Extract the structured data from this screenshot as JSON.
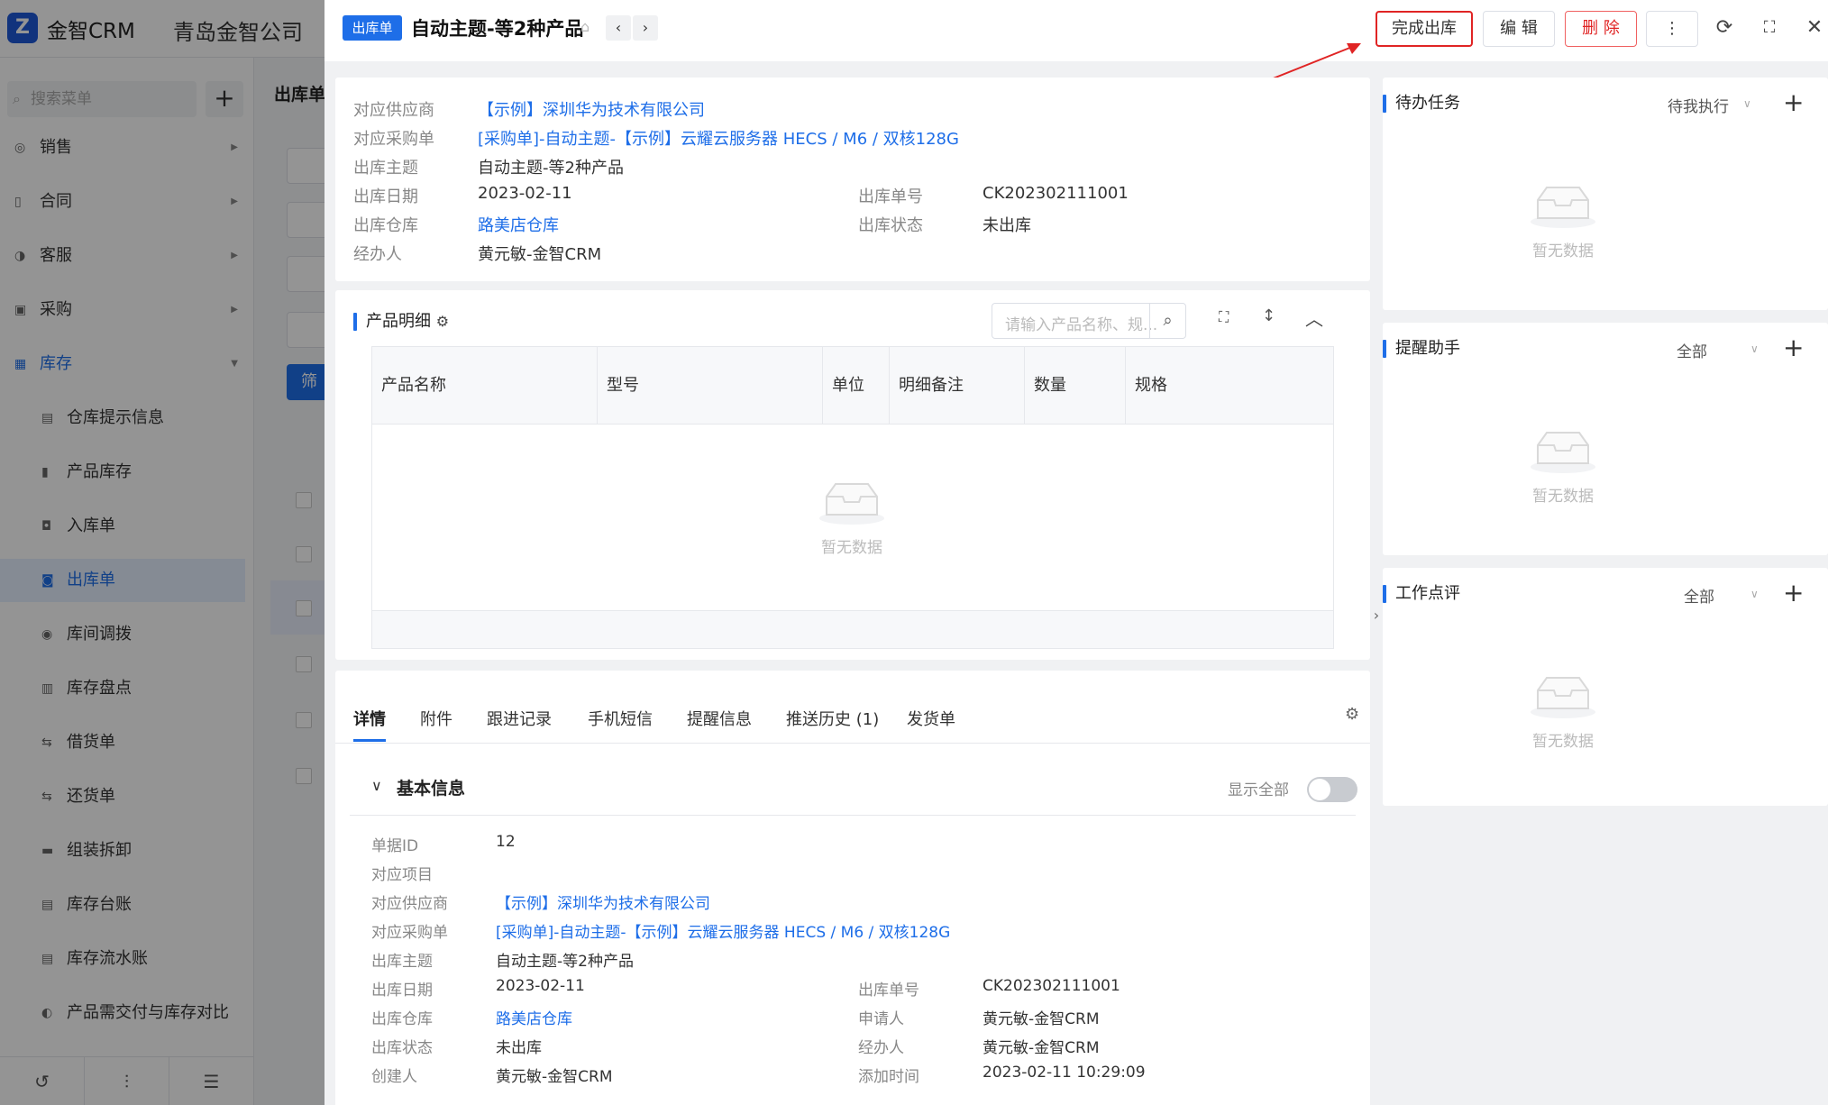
{
  "app": {
    "brand": "金智CRM",
    "company": "青岛金智公司"
  },
  "sidebar": {
    "search_placeholder": "搜索菜单",
    "menu": [
      {
        "label": "销售"
      },
      {
        "label": "合同"
      },
      {
        "label": "客服"
      },
      {
        "label": "采购"
      },
      {
        "label": "库存"
      }
    ],
    "sub_menu": [
      {
        "label": "仓库提示信息"
      },
      {
        "label": "产品库存"
      },
      {
        "label": "入库单"
      },
      {
        "label": "出库单"
      },
      {
        "label": "库间调拨"
      },
      {
        "label": "库存盘点"
      },
      {
        "label": "借货单"
      },
      {
        "label": "还货单"
      },
      {
        "label": "组装拆卸"
      },
      {
        "label": "库存台账"
      },
      {
        "label": "库存流水账"
      },
      {
        "label": "产品需交付与库存对比"
      }
    ]
  },
  "list": {
    "title": "出库单",
    "filter_label": "筛"
  },
  "drawer": {
    "tag": "出库单",
    "title": "自动主题-等2种产品",
    "buttons": {
      "complete": "完成出库",
      "edit": "编 辑",
      "delete": "删 除"
    },
    "summary": {
      "supplier_label": "对应供应商",
      "supplier_value": "【示例】深圳华为技术有限公司",
      "purchase_label": "对应采购单",
      "purchase_value": "[采购单]-自动主题-【示例】云耀云服务器 HECS / M6 / 双核128G",
      "subject_label": "出库主题",
      "subject_value": "自动主题-等2种产品",
      "date_label": "出库日期",
      "date_value": "2023-02-11",
      "number_label": "出库单号",
      "number_value": "CK202302111001",
      "warehouse_label": "出库仓库",
      "warehouse_value": "路美店仓库",
      "status_label": "出库状态",
      "status_value": "未出库",
      "handler_label": "经办人",
      "handler_value": "黄元敏-金智CRM"
    },
    "products": {
      "title": "产品明细",
      "search_placeholder": "请输入产品名称、规...",
      "columns": [
        "产品名称",
        "型号",
        "单位",
        "明细备注",
        "数量",
        "规格"
      ],
      "empty": "暂无数据"
    },
    "tabs": [
      "详情",
      "附件",
      "跟进记录",
      "手机短信",
      "提醒信息",
      "推送历史 (1)",
      "发货单"
    ],
    "basic": {
      "title": "基本信息",
      "show_all": "显示全部",
      "id_label": "单据ID",
      "id_value": "12",
      "project_label": "对应项目",
      "supplier_label": "对应供应商",
      "supplier_value": "【示例】深圳华为技术有限公司",
      "purchase_label": "对应采购单",
      "purchase_value": "[采购单]-自动主题-【示例】云耀云服务器 HECS / M6 / 双核128G",
      "subject_label": "出库主题",
      "subject_value": "自动主题-等2种产品",
      "date_label": "出库日期",
      "date_value": "2023-02-11",
      "number_label": "出库单号",
      "number_value": "CK202302111001",
      "warehouse_label": "出库仓库",
      "warehouse_value": "路美店仓库",
      "applicant_label": "申请人",
      "applicant_value": "黄元敏-金智CRM",
      "status_label": "出库状态",
      "status_value": "未出库",
      "handler_label": "经办人",
      "handler_value": "黄元敏-金智CRM",
      "creator_label": "创建人",
      "creator_value": "黄元敏-金智CRM",
      "added_label": "添加时间",
      "added_value": "2023-02-11 10:29:09"
    },
    "right": {
      "todo": {
        "title": "待办任务",
        "filter": "待我执行",
        "empty": "暂无数据"
      },
      "reminder": {
        "title": "提醒助手",
        "filter": "全部",
        "empty": "暂无数据"
      },
      "review": {
        "title": "工作点评",
        "filter": "全部",
        "empty": "暂无数据"
      }
    }
  },
  "colors": {
    "accent": "#1e6ee8",
    "highlight": "#e02424"
  }
}
